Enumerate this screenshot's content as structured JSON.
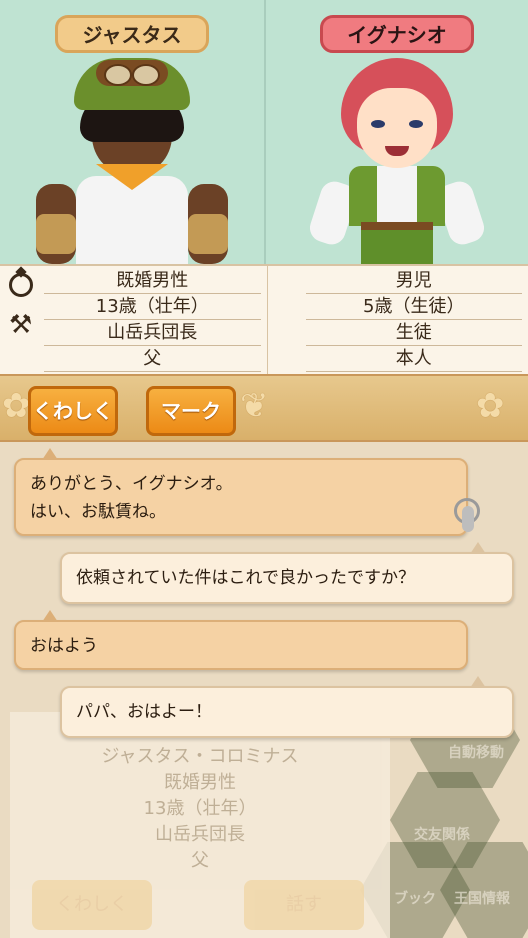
{
  "characters": {
    "left": {
      "name": "ジャスタス",
      "info": [
        "既婚男性",
        "13歳（壮年）",
        "山岳兵団長",
        "父"
      ]
    },
    "right": {
      "name": "イグナシオ",
      "info": [
        "男児",
        "5歳（生徒）",
        "生徒",
        "本人"
      ]
    }
  },
  "buttons": {
    "details": "くわしく",
    "mark": "マーク"
  },
  "chat": [
    {
      "text": "ありがとう、イグナシオ。\nはい、お駄賃ね。"
    },
    {
      "text": "依頼されていた件はこれで良かったですか？"
    },
    {
      "text": "おはよう"
    },
    {
      "text": "パパ、おはよー！"
    }
  ],
  "background": {
    "lines": [
      "ジャスタス・コロミナス",
      "既婚男性",
      "13歳（壮年）",
      "山岳兵団長",
      "父"
    ],
    "buttons": [
      "くわしく",
      "話す"
    ],
    "menu": [
      "自動移動",
      "交友関係",
      "ブック",
      "王国情報"
    ]
  },
  "colors": {
    "left_plate": "#f2cb8a",
    "right_plate": "#f07b80",
    "button": "#f7b040",
    "portrait_bg": "#bfe3d2"
  }
}
